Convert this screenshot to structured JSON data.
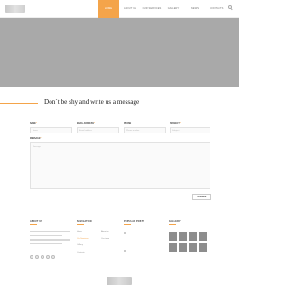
{
  "nav": {
    "items": [
      "HOME",
      "ABOUT US",
      "OUR SERVICES",
      "GALLERY",
      "NEWS",
      "CONTACTS"
    ],
    "active_index": 0,
    "accent": "#f4a44a"
  },
  "icons": {
    "search": "search-icon"
  },
  "contact": {
    "heading": "Don`t be shy and write us a message",
    "fields": [
      {
        "label": "NAME",
        "required": true,
        "placeholder": "Name"
      },
      {
        "label": "EMAIL ADDRESS",
        "required": true,
        "placeholder": "Email address"
      },
      {
        "label": "PHONE",
        "required": false,
        "placeholder": "Phone number"
      },
      {
        "label": "SUBJECT",
        "required": true,
        "placeholder": "Subject"
      }
    ],
    "message": {
      "label": "MESSAGE",
      "required": true,
      "placeholder": "Message"
    },
    "send_label": "SUBMIT",
    "required_mark": "*"
  },
  "footer": {
    "about": {
      "title": "ABOUT US"
    },
    "navigation": {
      "title": "NAVIGATION",
      "col1": [
        "Home",
        "Our Services",
        "Gallery",
        "Contacts"
      ],
      "col2": [
        "About us",
        "Our team"
      ],
      "highlighted": "Our Services"
    },
    "posts": {
      "title": "POPULAR POSTS"
    },
    "gallery": {
      "title": "GALLERY",
      "count": 8
    }
  }
}
